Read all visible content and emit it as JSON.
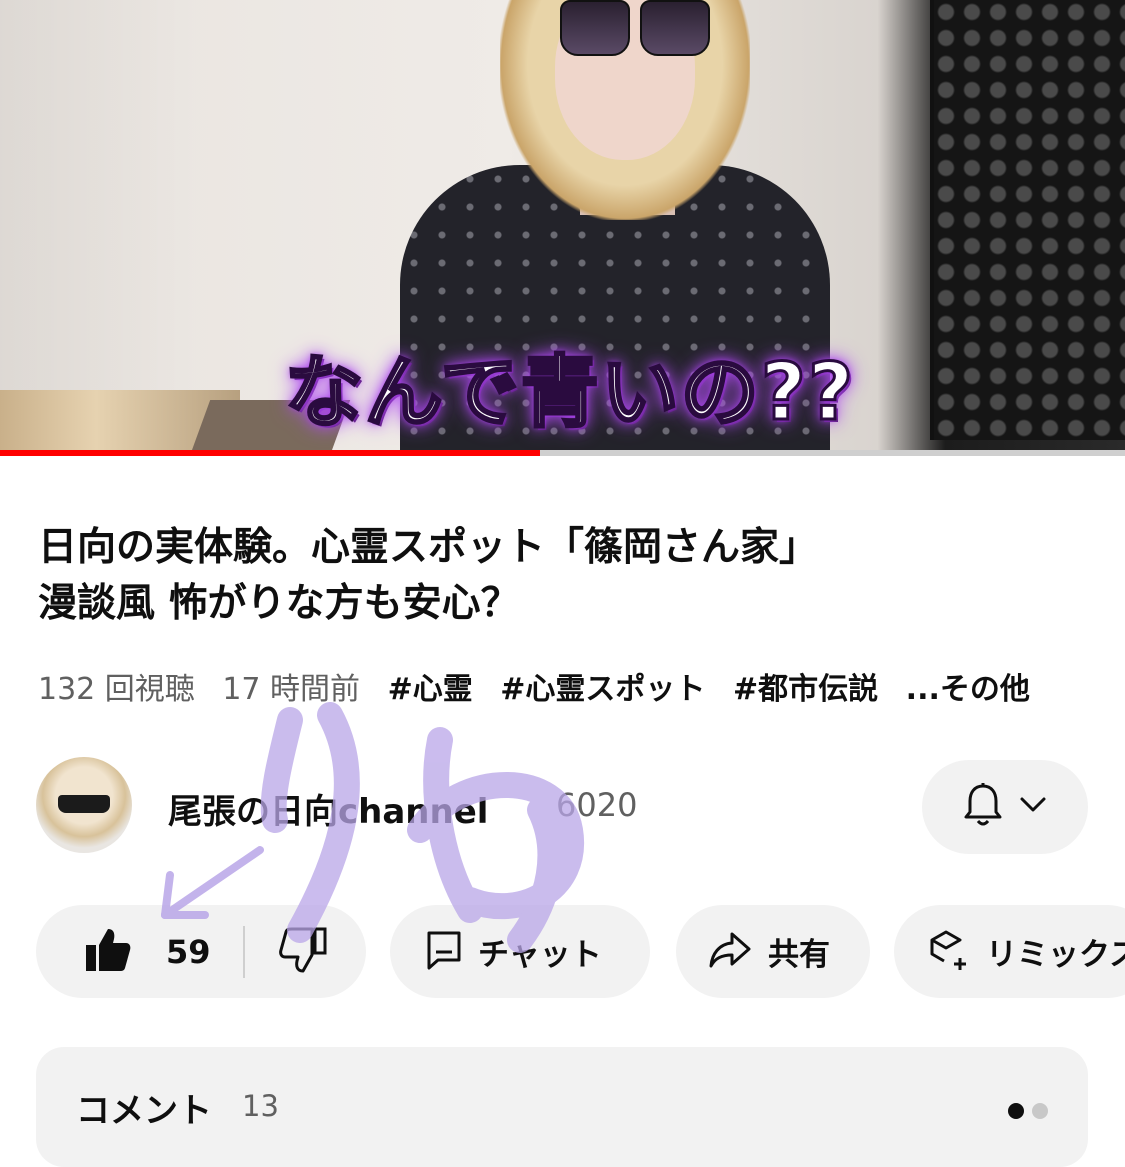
{
  "video": {
    "caption": "なんで青いの??",
    "progress_fraction": 0.48,
    "colors": {
      "progress": "#ff0000",
      "track": "#cfcfcf"
    }
  },
  "title": "日向の実体験。心霊スポット「篠岡さん家」\n漫談風 怖がりな方も安心？",
  "meta": {
    "views": "132 回視聴",
    "time": "17 時間前",
    "tags": [
      "#心霊",
      "#心霊スポット",
      "#都市伝説"
    ],
    "more": "...その他"
  },
  "channel": {
    "name": "尾張の日向channel",
    "subscribers": "6020",
    "bell_icon": "bell-icon",
    "dropdown_icon": "chevron-down-icon"
  },
  "actions": {
    "like_count": "59",
    "chat_label": "チャット",
    "share_label": "共有",
    "remix_label": "リミックス"
  },
  "comments": {
    "label": "コメント",
    "count": "13"
  },
  "overlay": {
    "handwriting": "りゅ",
    "color": "#b9a6e8"
  }
}
